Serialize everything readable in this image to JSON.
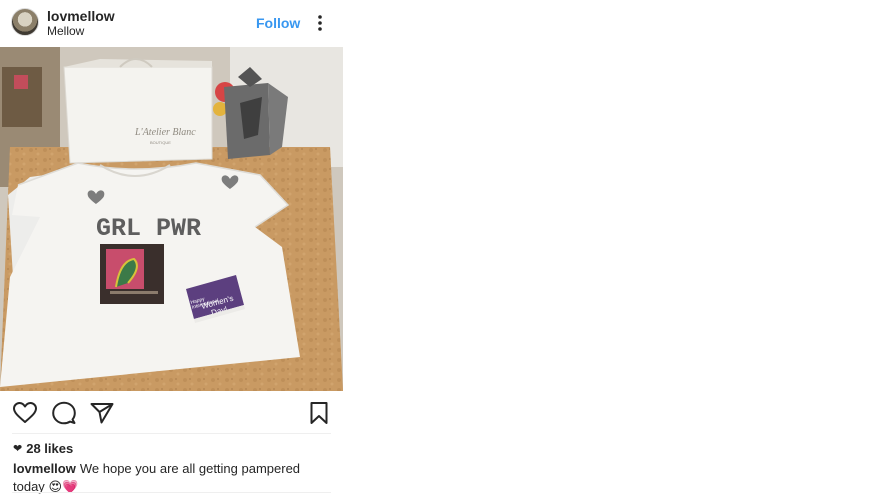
{
  "header": {
    "username": "lovmellow",
    "location": "Mellow",
    "follow_label": "Follow",
    "more_icon": "more-vertical-icon"
  },
  "photo": {
    "shirt_text": "GRL PWR",
    "card_lines": [
      "Happy",
      "International",
      "Women's",
      "Day!"
    ],
    "bag_brand": "L'Atelier Blanc",
    "bag_subtext": "BOUTIQUE"
  },
  "actions": {
    "icons": [
      "heart-outline-icon",
      "comment-icon",
      "share-icon",
      "bookmark-icon"
    ]
  },
  "likes": {
    "count_label": "28 likes"
  },
  "caption": {
    "username": "lovmellow",
    "text": "We hope you are all getting pampered today",
    "emojis": "😍💗"
  },
  "colors": {
    "follow_blue": "#3897f0",
    "text": "#262626",
    "card_purple": "#5c3f7f",
    "wood": "#c99a63"
  }
}
